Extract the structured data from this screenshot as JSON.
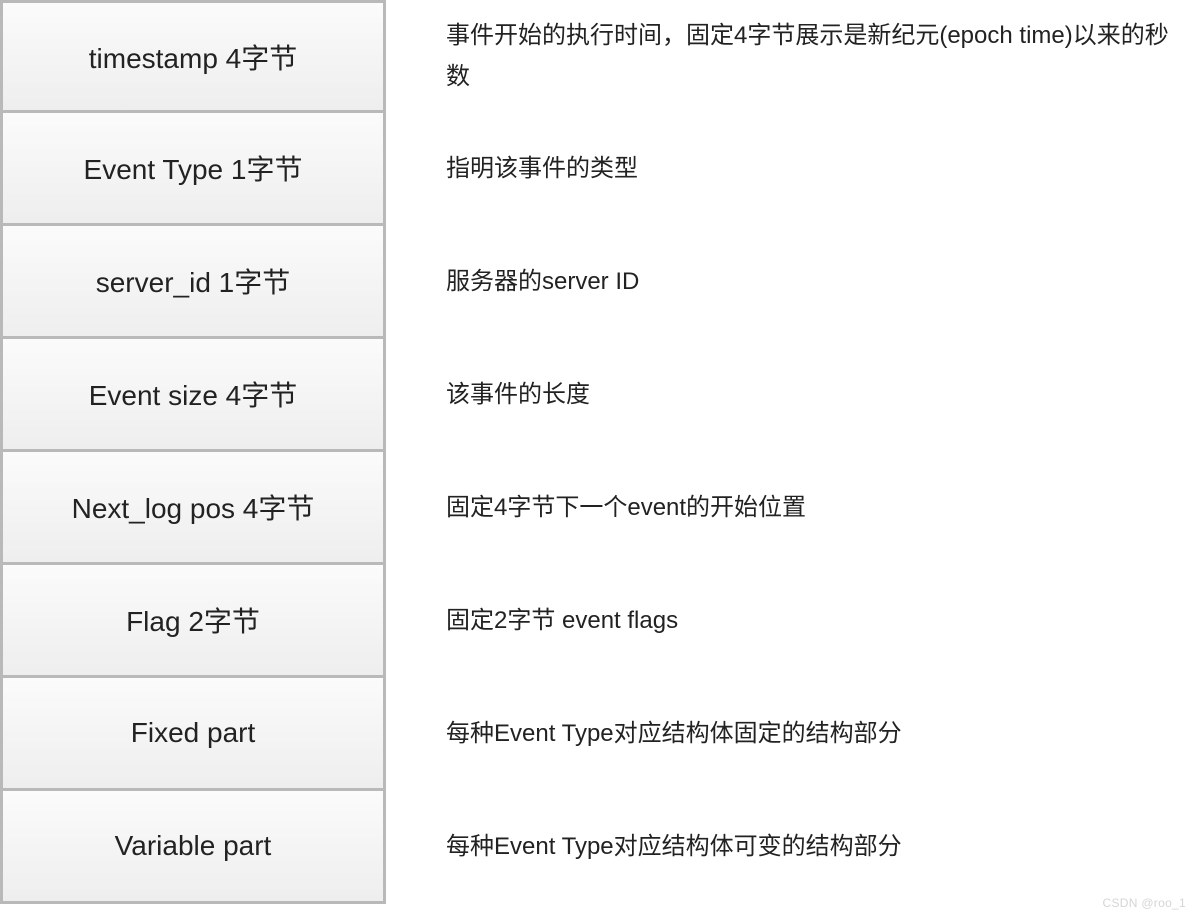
{
  "rows": [
    {
      "field": "timestamp 4字节",
      "desc": "事件开始的执行时间，固定4字节展示是新纪元(epoch time)以来的秒数"
    },
    {
      "field": "Event Type 1字节",
      "desc": "指明该事件的类型"
    },
    {
      "field": "server_id 1字节",
      "desc": "服务器的server ID"
    },
    {
      "field": "Event size  4字节",
      "desc": "该事件的长度"
    },
    {
      "field": "Next_log pos 4字节",
      "desc": "固定4字节下一个event的开始位置"
    },
    {
      "field": "Flag 2字节",
      "desc": "固定2字节 event flags"
    },
    {
      "field": "Fixed part",
      "desc": "每种Event Type对应结构体固定的结构部分"
    },
    {
      "field": "Variable part",
      "desc": "每种Event Type对应结构体可变的结构部分"
    }
  ],
  "watermark": "CSDN @roo_1"
}
